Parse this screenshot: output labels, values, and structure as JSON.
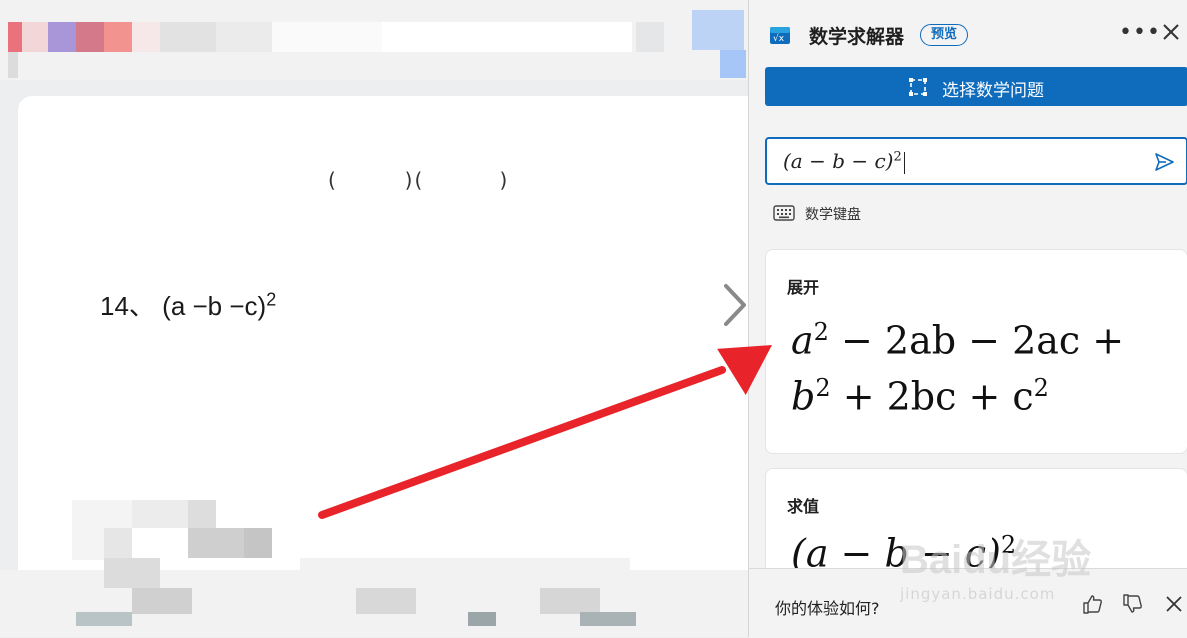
{
  "page": {
    "question_number": "14、",
    "question_expr": "(a −b −c)",
    "question_exp": "2"
  },
  "solver": {
    "title": "数学求解器",
    "badge": "预览",
    "more_icon": "more-icon",
    "select_button_label": "选择数学问题",
    "input": {
      "expression": "(a − b − c)",
      "exponent": "2"
    },
    "keyboard_label": "数学键盘",
    "expand_card": {
      "title": "展开",
      "line1": [
        "a",
        "2",
        " − 2ab − 2ac +"
      ],
      "line2": [
        "b",
        "2",
        " + 2bc + c",
        "2"
      ]
    },
    "evaluate_card": {
      "title": "求值",
      "expr": "(a − b − c)",
      "exp": "2"
    },
    "feedback_question": "你的体验如何?"
  },
  "watermark": {
    "brand": "Baidu经验",
    "url": "jingyan.baidu.com"
  },
  "colors": {
    "accent": "#0f6cbd",
    "arrow": "#e8232a"
  }
}
